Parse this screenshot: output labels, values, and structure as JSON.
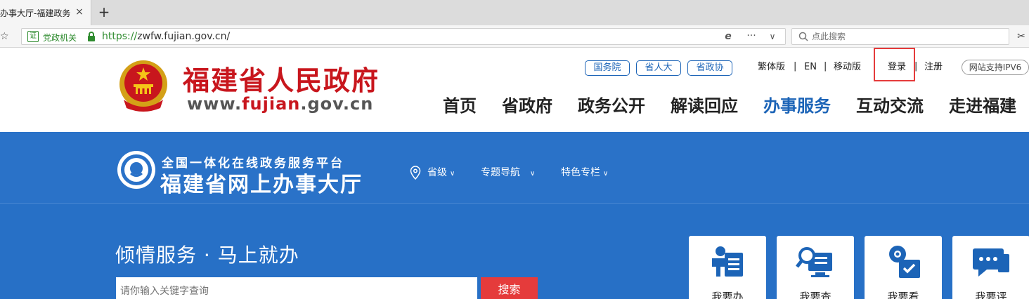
{
  "browser": {
    "tab_title": "办事大厅-福建政务",
    "tab_close": "×",
    "new_tab": "+",
    "cert_label": "党政机关",
    "cert_badge": "证",
    "url_scheme": "https://",
    "url_rest": "zwfw.fujian.gov.cn/",
    "search_placeholder": "点此搜索",
    "more": "···",
    "dropdown": "∨",
    "ie_glyph": "e",
    "scissors": "✂",
    "star_menu": "☆"
  },
  "header": {
    "site_title": "福建省人民政府",
    "site_url_prefix": "www.",
    "site_url_highlight": "fujian",
    "site_url_suffix": ".gov.cn",
    "quick_links": [
      "国务院",
      "省人大",
      "省政协"
    ],
    "lang_traditional": "繁体版",
    "lang_en": "EN",
    "mobile": "移动版",
    "login": "登录",
    "register": "注册",
    "ipv6": "网站支持IPV6",
    "separator": "|"
  },
  "main_nav": [
    "首页",
    "省政府",
    "政务公开",
    "解读回应",
    "办事服务",
    "互动交流",
    "走进福建"
  ],
  "banner": {
    "subtitle": "全国一体化在线政务服务平台",
    "title": "福建省网上办事大厅",
    "nav": [
      "省级",
      "专题导航",
      "特色专栏"
    ],
    "chevron": "∨",
    "slogan": "倾情服务 · 马上就办",
    "search_placeholder": "请你输入关键字查询",
    "search_button": "搜索",
    "cards": [
      "我要办",
      "我要查",
      "我要看",
      "我要评"
    ]
  },
  "colors": {
    "brand_red": "#c8161d",
    "nav_blue": "#1c64b7",
    "banner_blue": "#2770c6",
    "search_red": "#e53b3b"
  }
}
